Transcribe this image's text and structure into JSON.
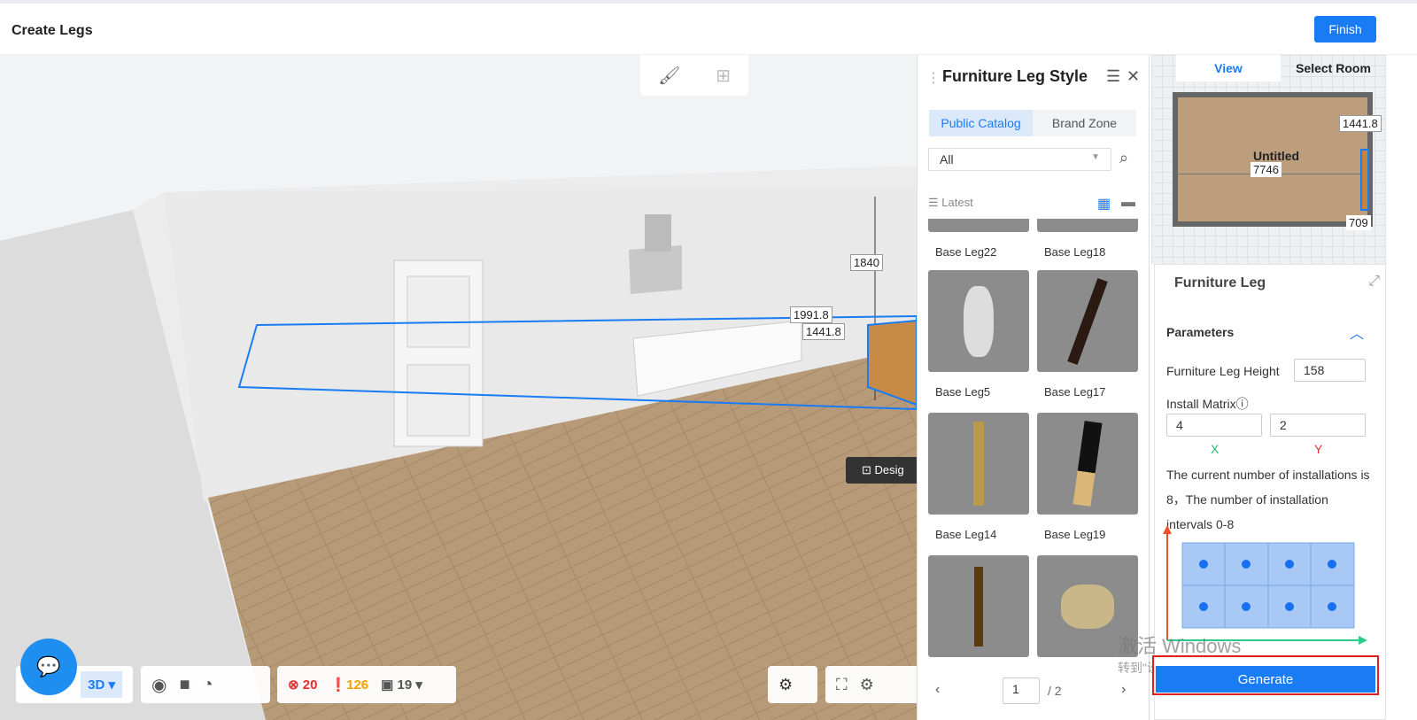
{
  "header": {
    "title": "Create Legs",
    "finish": "Finish"
  },
  "scene": {
    "dims": [
      "1840",
      "1991.8",
      "1441.8"
    ],
    "design_label": "Desig"
  },
  "toolbar": {
    "view_mode": "3D",
    "errors": "20",
    "warnings": "126",
    "items": "19"
  },
  "library": {
    "title": "Furniture Leg Style",
    "tabs": [
      "Public Catalog",
      "Brand Zone"
    ],
    "filter": "All",
    "sort": "Latest",
    "items": [
      {
        "label": "Base Leg22"
      },
      {
        "label": "Base Leg18"
      },
      {
        "label": "Base Leg5"
      },
      {
        "label": "Base Leg17"
      },
      {
        "label": "Base Leg14"
      },
      {
        "label": "Base Leg19"
      }
    ],
    "page": "1",
    "total_pages": "/ 2"
  },
  "minimap": {
    "tabs": [
      "View",
      "Select Room"
    ],
    "room_name": "Untitled",
    "dims": [
      "1441.8",
      "7746",
      "709"
    ]
  },
  "leg_panel": {
    "title": "Furniture Leg",
    "section": "Parameters",
    "height_label": "Furniture Leg Height",
    "height_value": "158",
    "matrix_label": "Install Matrix",
    "matrix_x": "4",
    "matrix_y": "2",
    "x_label": "X",
    "y_label": "Y",
    "info": "The current number of installations is 8，The number of installation intervals 0-8",
    "generate": "Generate"
  },
  "watermark": {
    "line1": "激活 Windows",
    "line2": "转到\"设置\"以激活 Windows。"
  },
  "colors": {
    "accent": "#1a7cf5",
    "error": "#e53030",
    "warning": "#f5a100"
  }
}
